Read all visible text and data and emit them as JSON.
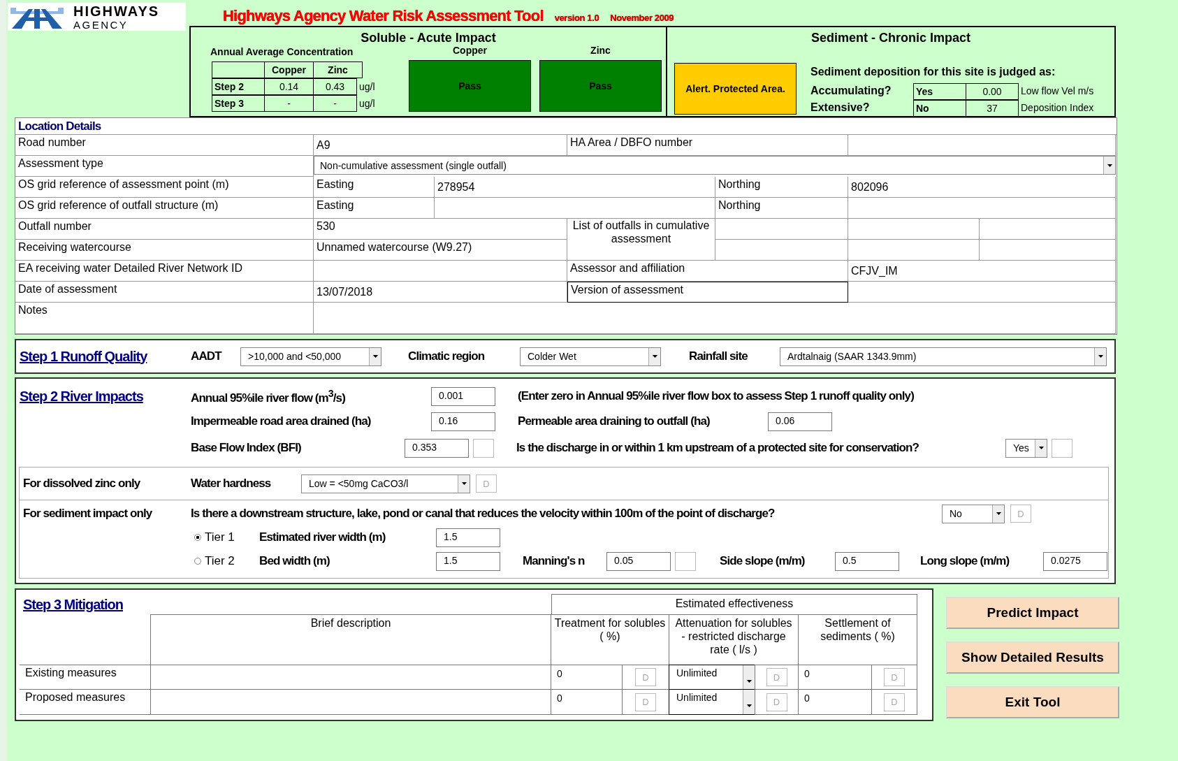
{
  "header": {
    "logo_line1": "HIGHWAYS",
    "logo_line2": "AGENCY",
    "title": "Highways Agency Water Risk Assessment Tool",
    "version": "version 1.0",
    "date": "November 2009"
  },
  "soluble": {
    "title": "Soluble - Acute Impact",
    "concentration_title": "Annual Average Concentration",
    "columns": [
      "Copper",
      "Zinc"
    ],
    "rows": [
      {
        "label": "Step 2",
        "copper": "0.14",
        "zinc": "0.43",
        "unit": "ug/l"
      },
      {
        "label": "Step 3",
        "copper": "-",
        "zinc": "-",
        "unit": "ug/l"
      }
    ],
    "results": [
      {
        "metal": "Copper",
        "result": "Pass",
        "kind": "pass"
      },
      {
        "metal": "Zinc",
        "result": "Pass",
        "kind": "pass"
      }
    ]
  },
  "sediment": {
    "title": "Sediment - Chronic Impact",
    "result": {
      "text": "Alert. Protected Area.",
      "kind": "alert"
    },
    "judged": "Sediment deposition for this site is judged as:",
    "rows": [
      {
        "question": "Accumulating?",
        "answer": "Yes",
        "value": "0.00",
        "unit": "Low flow Vel m/s"
      },
      {
        "question": "Extensive?",
        "answer": "No",
        "value": "37",
        "unit": "Deposition Index"
      }
    ]
  },
  "location": {
    "title": "Location Details",
    "road_number": {
      "label": "Road number",
      "value": "A9"
    },
    "ha_area": {
      "label": "HA Area / DBFO number"
    },
    "assessment_type": {
      "label": "Assessment type",
      "value": "Non-cumulative assessment (single outfall)"
    },
    "grid_assessment": {
      "label": "OS grid reference of assessment point (m)",
      "easting_label": "Easting",
      "easting": "278954",
      "northing_label": "Northing",
      "northing": "802096"
    },
    "grid_outfall": {
      "label": "OS grid reference of outfall structure (m)",
      "easting_label": "Easting",
      "northing_label": "Northing"
    },
    "outfall_number": {
      "label": "Outfall number",
      "value": "530"
    },
    "outfalls_list": {
      "label": "List of outfalls in cumulative   assessment"
    },
    "receiving_watercourse": {
      "label": "Receiving watercourse",
      "value": "Unnamed watercourse (W9.27)"
    },
    "ea_id": {
      "label": "EA receiving water Detailed River Network ID"
    },
    "assessor": {
      "label": "Assessor and affiliation",
      "value": "CFJV_IM"
    },
    "date": {
      "label": "Date of assessment",
      "value": "13/07/2018"
    },
    "version": {
      "label": "Version of assessment"
    },
    "notes": {
      "label": "Notes"
    }
  },
  "step1": {
    "title": "Step 1  Runoff Quality",
    "fields": [
      {
        "label": "AADT",
        "value": ">10,000 and <50,000"
      },
      {
        "label": "Climatic region",
        "value": "Colder Wet"
      },
      {
        "label": "Rainfall site",
        "value": "Ardtalnaig (SAAR 1343.9mm)"
      }
    ]
  },
  "step2": {
    "title": "Step 2  River Impacts",
    "river_flow": {
      "label": "Annual  95%ile river flow (m$^{3}$/s)",
      "value": "0.001",
      "note": "(Enter zero in Annual 95%ile river flow box  to assess Step 1 runoff  quality only)"
    },
    "impermeable": {
      "label": "Impermeable road area drained (ha)",
      "value": "0.16"
    },
    "permeable": {
      "label": "Permeable area draining to outfall  (ha)",
      "value": "0.06"
    },
    "bfi": {
      "label": "Base Flow Index  (BFI)",
      "value": "0.353"
    },
    "protected": {
      "label": "Is the discharge in or within 1 km upstream  of a protected site for conservation?",
      "value": "Yes"
    },
    "zinc": {
      "title": "For dissolved zinc only",
      "label": "Water hardness",
      "value": "Low = <50mg CaCO3/l",
      "flag": "D"
    },
    "sediment": {
      "title": "For sediment impact only",
      "question": "Is there a downstream  structure,  lake, pond or canal that reduces the velocity  within 100m of the point of discharge?",
      "answer": "No",
      "flag": "D",
      "tiers": [
        {
          "label": "Tier 1",
          "selected": true
        },
        {
          "label": "Tier 2",
          "selected": false
        }
      ],
      "river_width": {
        "label": "Estimated river width (m)",
        "value": "1.5"
      },
      "bed_width": {
        "label": "Bed width (m)",
        "value": "1.5"
      },
      "manning": {
        "label": "Manning's n",
        "value": "0.05"
      },
      "side_slope": {
        "label": "Side slope (m/m)",
        "value": "0.5"
      },
      "long_slope": {
        "label": "Long slope (m/m)",
        "value": "0.0275"
      }
    }
  },
  "step3": {
    "title": "Step 3  Mitigation",
    "group_header": "Estimated effectiveness",
    "columns": [
      "Brief description",
      "Treatment for solubles ( %)",
      "Attenuation for solubles - restricted discharge rate ( l/s )",
      "Settlement of sediments ( %)"
    ],
    "rows": [
      {
        "label": "Existing measures",
        "treatment": "0",
        "treatment_flag": "D",
        "attenuation": "Unlimited",
        "attenuation_flag": "D",
        "settlement": "0",
        "settlement_flag": "D"
      },
      {
        "label": "Proposed measures",
        "treatment": "0",
        "treatment_flag": "D",
        "attenuation": "Unlimited",
        "attenuation_flag": "D",
        "settlement": "0",
        "settlement_flag": "D"
      }
    ]
  },
  "buttons": [
    "Predict Impact",
    "Show Detailed Results",
    "Exit Tool"
  ]
}
